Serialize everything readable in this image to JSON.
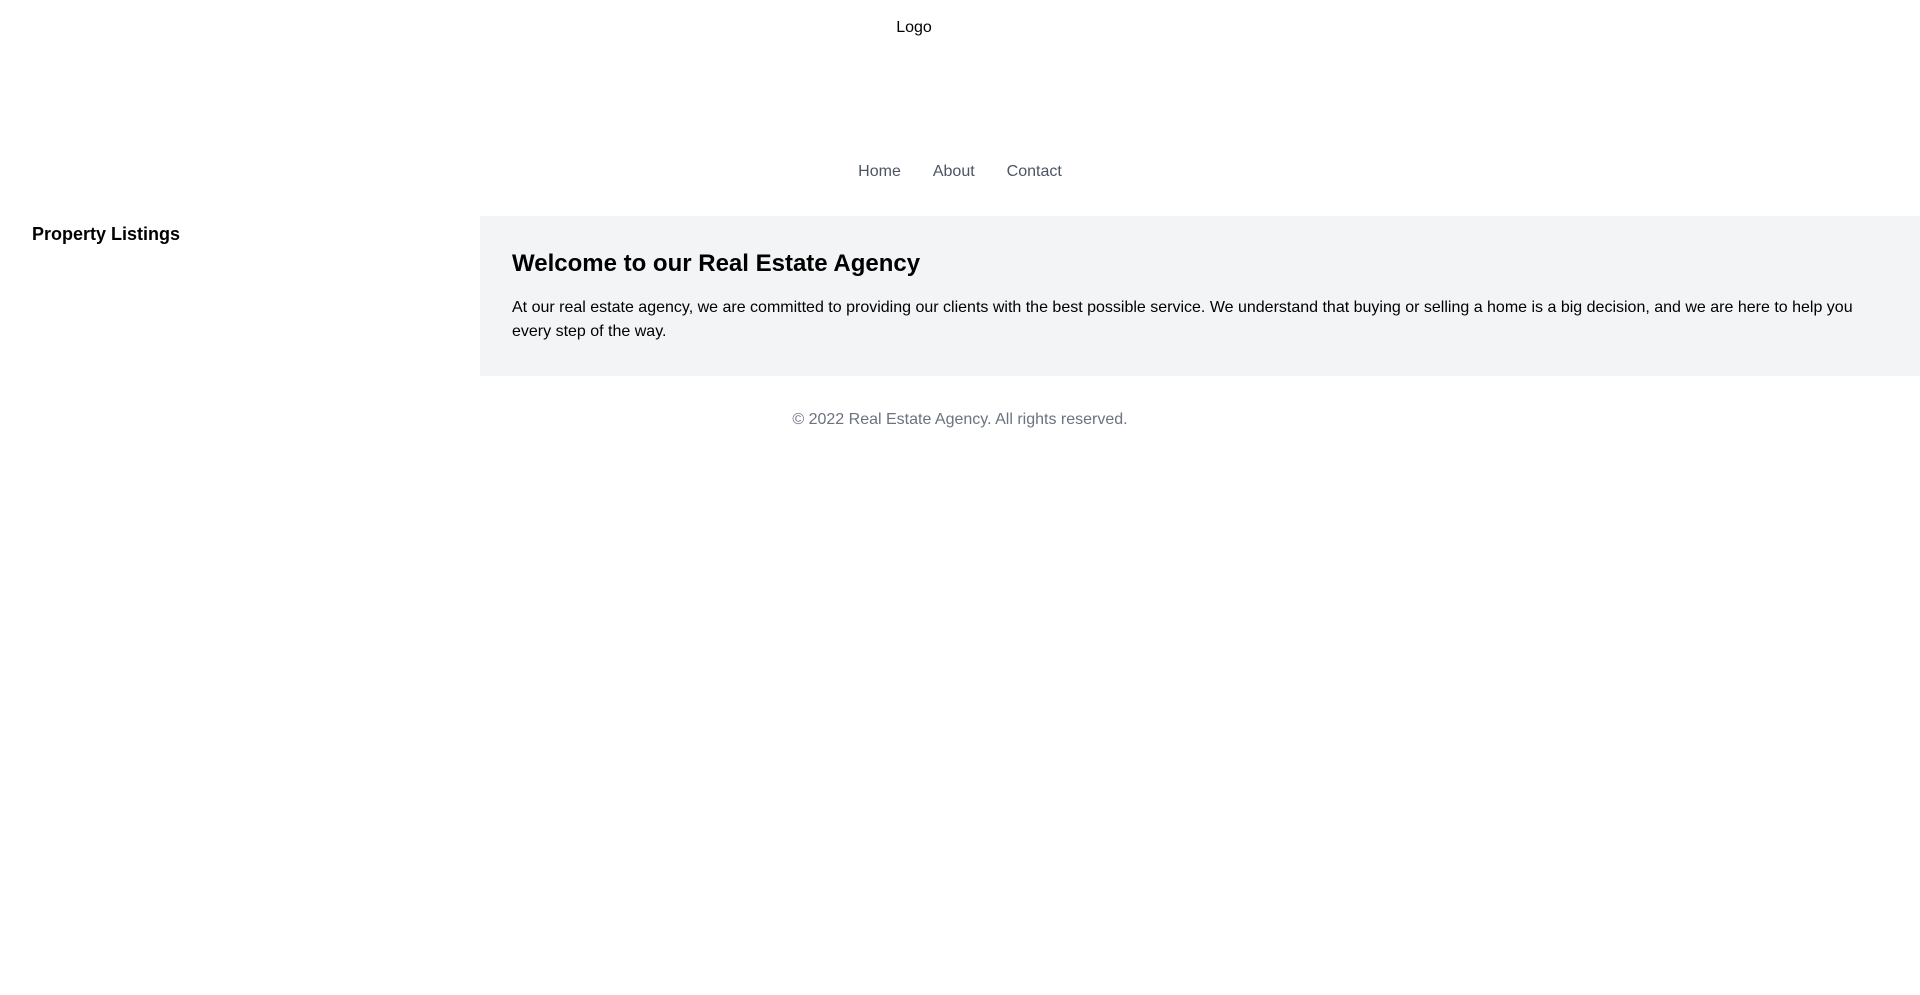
{
  "header": {
    "logo_text": "Logo"
  },
  "nav": {
    "items": [
      {
        "label": "Home"
      },
      {
        "label": "About"
      },
      {
        "label": "Contact"
      }
    ]
  },
  "sidebar": {
    "title": "Property Listings"
  },
  "main": {
    "title": "Welcome to our Real Estate Agency",
    "body": "At our real estate agency, we are committed to providing our clients with the best possible service. We understand that buying or selling a home is a big decision, and we are here to help you every step of the way."
  },
  "footer": {
    "copyright": "© 2022 Real Estate Agency. All rights reserved."
  },
  "colors": {
    "nav_text": "#4b5563",
    "main_background": "#f3f4f6",
    "footer_text": "#6b7280"
  }
}
